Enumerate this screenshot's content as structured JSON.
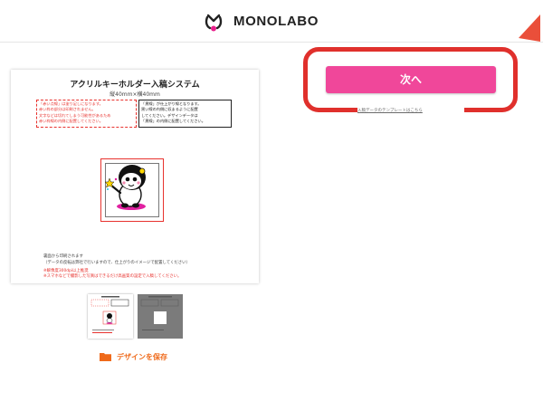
{
  "header": {
    "brand": "MONOLABO"
  },
  "preview": {
    "title": "アクリルキーホルダー入稿システム",
    "subtitle": "縦40mm×横40mm",
    "note_red": [
      "「赤い点線」は塗り足しになります。",
      "赤い枠の部分は印刷されません。",
      "文字などは切れてしまう可能性があるため",
      "赤い枠線の内側に配置してください。"
    ],
    "note_black": [
      "「黒線」が仕上がり線となります。",
      "黒い線の内側に収まるように配置",
      "してください。デザインデータは",
      "「黒線」の内側に配置してください。"
    ],
    "footer_line1": "裏面から印刷されます",
    "footer_line2": "（データの反転は弊社で行いますので、仕上がりのイメージで配置してください）",
    "footer_line3": "※解像度300dpi以上推奨",
    "footer_line4": "※スマホなどで撮影した写真はできるだけ高画質の設定で入稿してください。"
  },
  "actions": {
    "save_label": "デザインを保存",
    "next_label": "次へ",
    "next_caption": "入稿データのテンプレートはこちら"
  },
  "colors": {
    "accent_pink": "#f0479a",
    "highlight_red": "#e0302c",
    "save_orange": "#ef6a1b"
  },
  "icons": {
    "logo": "monolabo-logo-icon",
    "folder": "folder-icon",
    "annotation": "red-triangle-arrow-icon"
  }
}
